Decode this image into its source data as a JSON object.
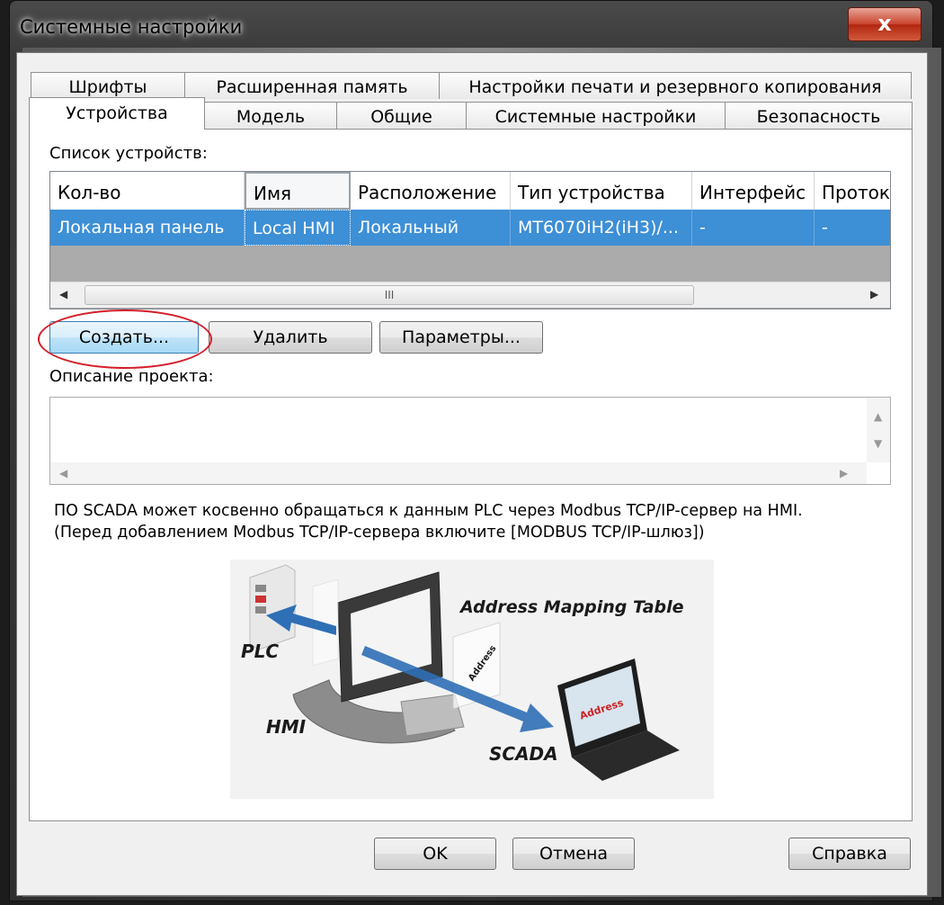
{
  "window": {
    "title": "Системные настройки",
    "close_glyph": "x"
  },
  "tabs_row1": [
    {
      "label": "Шрифты"
    },
    {
      "label": "Расширенная память"
    },
    {
      "label": "Настройки печати и резервного копирования"
    }
  ],
  "tabs_row2": [
    {
      "label": "Устройства",
      "active": true
    },
    {
      "label": "Модель"
    },
    {
      "label": "Общие"
    },
    {
      "label": "Системные настройки"
    },
    {
      "label": "Безопасность"
    }
  ],
  "devices": {
    "list_label": "Список устройств:",
    "columns": [
      "Кол-во",
      "Имя",
      "Расположение",
      "Тип устройства",
      "Интерфейс",
      "Протокол"
    ],
    "rows": [
      [
        "Локальная панель",
        "Local HMI",
        "Локальный",
        "MT6070iH2(iH3)/...",
        "-",
        "-"
      ]
    ],
    "scroll_thumb_glyph": "III"
  },
  "buttons": {
    "create": "Создать...",
    "delete": "Удалить",
    "params": "Параметры..."
  },
  "description": {
    "label": "Описание проекта:",
    "value": ""
  },
  "note": {
    "line1": "ПО SCADA может косвенно обращаться к данным PLC через Modbus TCP/IP-сервер на HMI.",
    "line2": "(Перед добавлением Modbus TCP/IP-сервера включите [MODBUS TCP/IP-шлюз])"
  },
  "illustration": {
    "title": "Address Mapping Table",
    "plc": "PLC",
    "hmi": "HMI",
    "scada": "SCADA",
    "address_tag": "Address",
    "screen_tag": "Address"
  },
  "footer": {
    "ok": "OK",
    "cancel": "Отмена",
    "help": "Справка"
  },
  "colors": {
    "selection": "#3d8fd6",
    "highlight_oval": "#d41f2a",
    "close_button": "#c9432c"
  }
}
